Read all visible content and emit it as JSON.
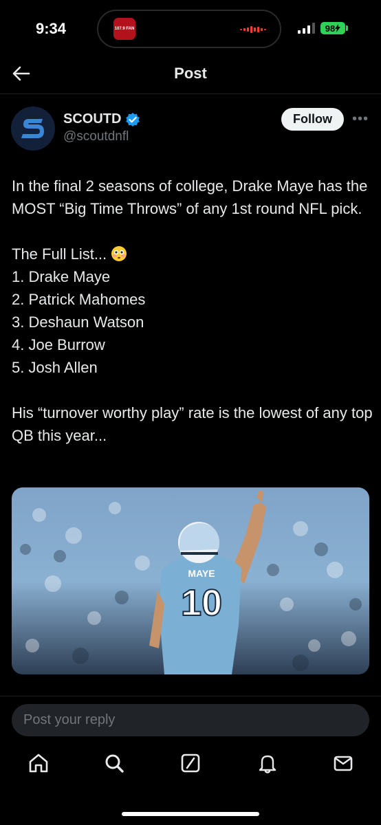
{
  "status_bar": {
    "time": "9:34",
    "battery": "98",
    "island_app_label": "107.9 FAN"
  },
  "header": {
    "title": "Post"
  },
  "post": {
    "author_name": "SCOUTD",
    "author_handle": "@scoutdnfl",
    "follow_label": "Follow",
    "more_label": "•••",
    "intro": "In the final 2 seasons of college, Drake Maye has the MOST “Big Time Throws” of any 1st round NFL pick.",
    "list_heading": "The Full List...",
    "list_items": [
      "1. Drake Maye",
      "2. Patrick Mahomes",
      "3. Deshaun Watson",
      "4. Joe Burrow",
      "5. Josh Allen"
    ],
    "outro": "His “turnover worthy play” rate is the lowest of any top QB this year...",
    "image": {
      "jersey_name": "MAYE",
      "jersey_number": "10"
    }
  },
  "reply": {
    "placeholder": "Post your reply"
  },
  "colors": {
    "verified": "#1d9bf0",
    "battery": "#30d158",
    "jersey": "#7bafd4"
  }
}
